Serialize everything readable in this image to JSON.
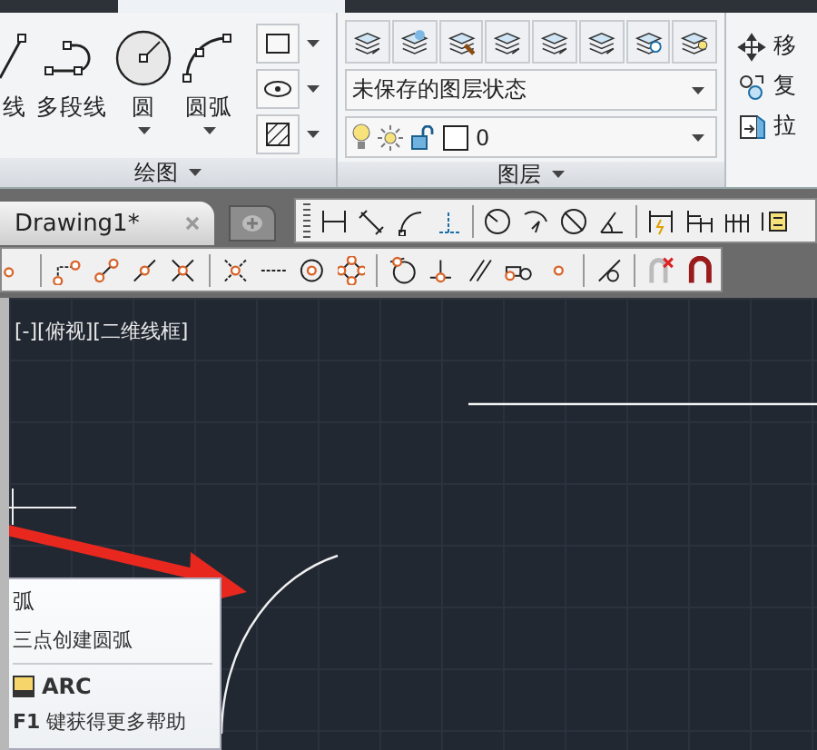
{
  "draw_panel": {
    "title": "绘图",
    "tools": [
      {
        "kind": "line",
        "label": "线",
        "dropdown": false
      },
      {
        "kind": "polyline",
        "label": "多段线",
        "dropdown": false
      },
      {
        "kind": "circle",
        "label": "圆",
        "dropdown": true
      },
      {
        "kind": "arc",
        "label": "圆弧",
        "dropdown": true
      }
    ]
  },
  "layers_panel": {
    "title": "图层",
    "layer_state": "未保存的图层状态",
    "current_layer": "0"
  },
  "modify_panel": {
    "tools": [
      {
        "kind": "move",
        "label": "移"
      },
      {
        "kind": "copy",
        "label": "复"
      },
      {
        "kind": "stretch",
        "label": "拉"
      }
    ]
  },
  "file_tabs": [
    {
      "label": "Drawing1*",
      "selected": true
    }
  ],
  "viewport": {
    "label": "[-][俯视][二维线框]"
  },
  "tooltip": {
    "title": "弧",
    "description": "三点创建圆弧",
    "command": "ARC",
    "help": "**F1** 键获得更多帮助"
  }
}
